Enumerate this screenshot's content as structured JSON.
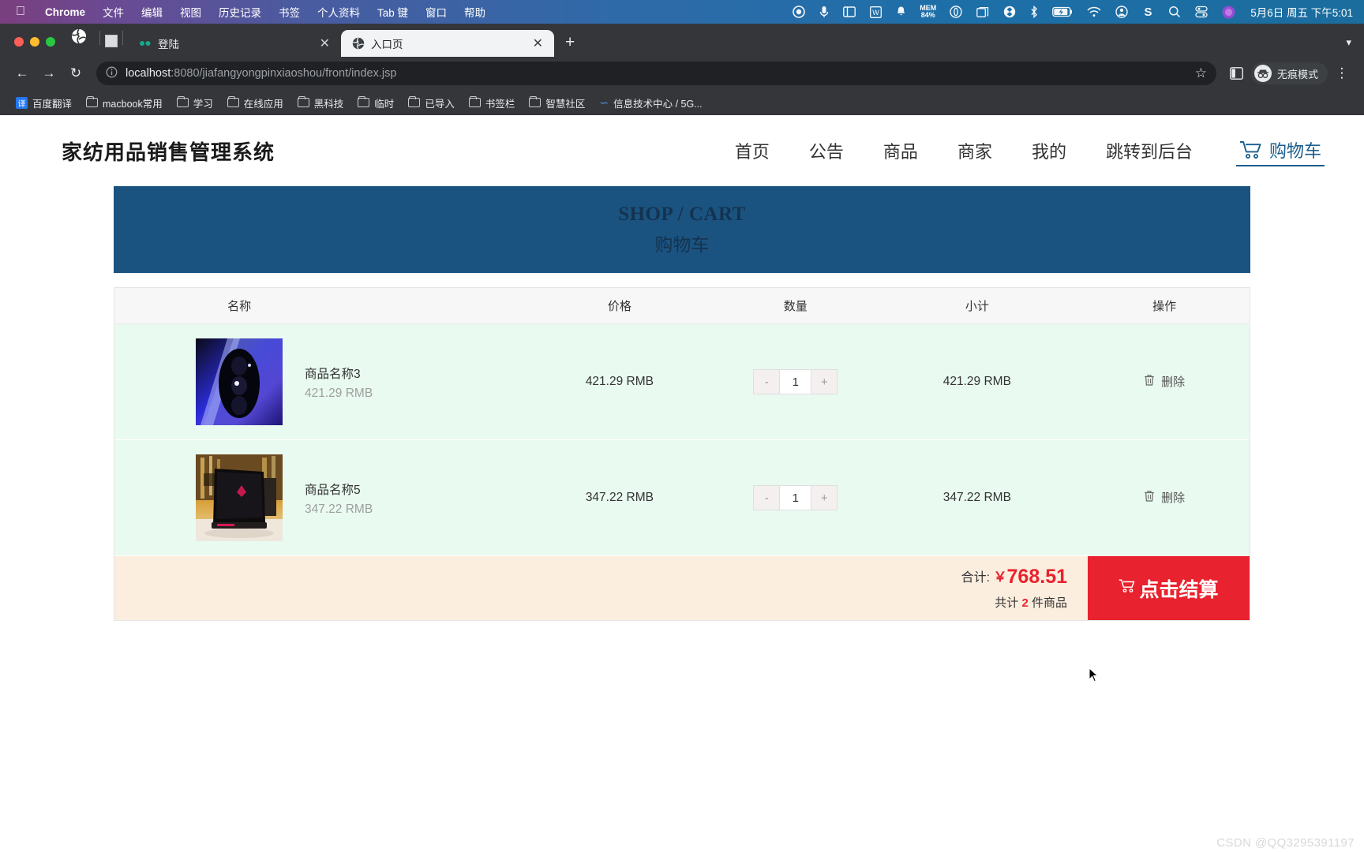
{
  "os_menubar": {
    "apple_icon": "apple-logo-icon",
    "items": [
      {
        "label": "Chrome",
        "bold": true
      },
      {
        "label": "文件",
        "bold": false
      },
      {
        "label": "编辑",
        "bold": false
      },
      {
        "label": "视图",
        "bold": false
      },
      {
        "label": "历史记录",
        "bold": false
      },
      {
        "label": "书签",
        "bold": false
      },
      {
        "label": "个人资料",
        "bold": false
      },
      {
        "label": "Tab 键",
        "bold": false
      },
      {
        "label": "窗口",
        "bold": false
      },
      {
        "label": "帮助",
        "bold": false
      }
    ],
    "status_icons": [
      {
        "name": "record-circle-icon",
        "glyph": "◉"
      },
      {
        "name": "microphone-icon",
        "glyph": "Ἲ4"
      },
      {
        "name": "screen-share-icon",
        "glyph": "▣"
      },
      {
        "name": "wps-icon",
        "glyph": "W"
      },
      {
        "name": "bell-icon",
        "glyph": "ὑ4"
      }
    ],
    "memory": {
      "label": "MEM",
      "value": "84%"
    },
    "clock": "5月6日 周五 下午5:01"
  },
  "browser": {
    "tabs": [
      {
        "title": "登陆",
        "active": false,
        "favicon": "globe-icon",
        "has_audio_dots": true
      },
      {
        "title": "入口页",
        "active": true,
        "favicon": "globe-icon",
        "has_audio_dots": false
      }
    ],
    "new_tab_label": "+",
    "tab_list_chevron": "▾",
    "back_label": "←",
    "forward_label": "→",
    "reload_label": "↻",
    "site_info_icon": "info-circle-icon",
    "url_host": "localhost",
    "url_path": ":8080/jiafangyongpinxiaoshou/front/index.jsp",
    "bookmark_star": "☆",
    "side_panel_icon": "side-panel-icon",
    "incognito_label": "无痕模式",
    "menu_label": "⋮",
    "bookmarks": [
      {
        "label": "百度翻译",
        "icon": "translate-badge-icon",
        "badge_text": "译"
      },
      {
        "label": "macbook常用",
        "icon": "folder-icon"
      },
      {
        "label": "学习",
        "icon": "folder-icon"
      },
      {
        "label": "在线应用",
        "icon": "folder-icon"
      },
      {
        "label": "黑科技",
        "icon": "folder-icon"
      },
      {
        "label": "临时",
        "icon": "folder-icon"
      },
      {
        "label": "已导入",
        "icon": "folder-icon"
      },
      {
        "label": "书签栏",
        "icon": "folder-icon"
      },
      {
        "label": "智慧社区",
        "icon": "folder-icon"
      },
      {
        "label": "信息技术中心 / 5G...",
        "icon": "wave-icon"
      }
    ]
  },
  "site": {
    "brand": "家纺用品销售管理系统",
    "nav": [
      {
        "label": "首页"
      },
      {
        "label": "公告"
      },
      {
        "label": "商品"
      },
      {
        "label": "商家"
      },
      {
        "label": "我的"
      },
      {
        "label": "跳转到后台"
      }
    ],
    "cart_link": {
      "label": "购物车",
      "icon": "shopping-cart-icon",
      "accent": "#1b5e8e"
    }
  },
  "banner": {
    "english": "SHOP / CART",
    "chinese": "购物车",
    "bg_color": "#1b5380",
    "text_color": "#14334f"
  },
  "cart": {
    "columns": [
      "名称",
      "价格",
      "数量",
      "小计",
      "操作"
    ],
    "row_bg_color": "#e9faf0",
    "items": [
      {
        "name": "商品名称3",
        "unit_price_sub": "421.29 RMB",
        "price": "421.29 RMB",
        "quantity": "1",
        "subtotal": "421.29 RMB",
        "delete_label": "删除",
        "delete_icon": "trash-icon",
        "minus_label": "-",
        "plus_label": "+",
        "thumb_alt": "purple-blue-phone-camera-photo"
      },
      {
        "name": "商品名称5",
        "unit_price_sub": "347.22 RMB",
        "price": "347.22 RMB",
        "quantity": "1",
        "subtotal": "347.22 RMB",
        "delete_label": "删除",
        "delete_icon": "trash-icon",
        "minus_label": "-",
        "plus_label": "+",
        "thumb_alt": "black-gaming-laptop-on-desk-photo"
      }
    ],
    "footer": {
      "total_label": "合计:",
      "currency": "￥",
      "total_amount": "768.51",
      "count_prefix": "共计",
      "count_value": "2",
      "count_suffix": "件商品",
      "checkout_label": "点击结算",
      "checkout_icon": "shopping-cart-icon",
      "checkout_color": "#e8222e",
      "footer_bg": "#fceede"
    }
  },
  "watermark": "CSDN @QQ3295391197"
}
